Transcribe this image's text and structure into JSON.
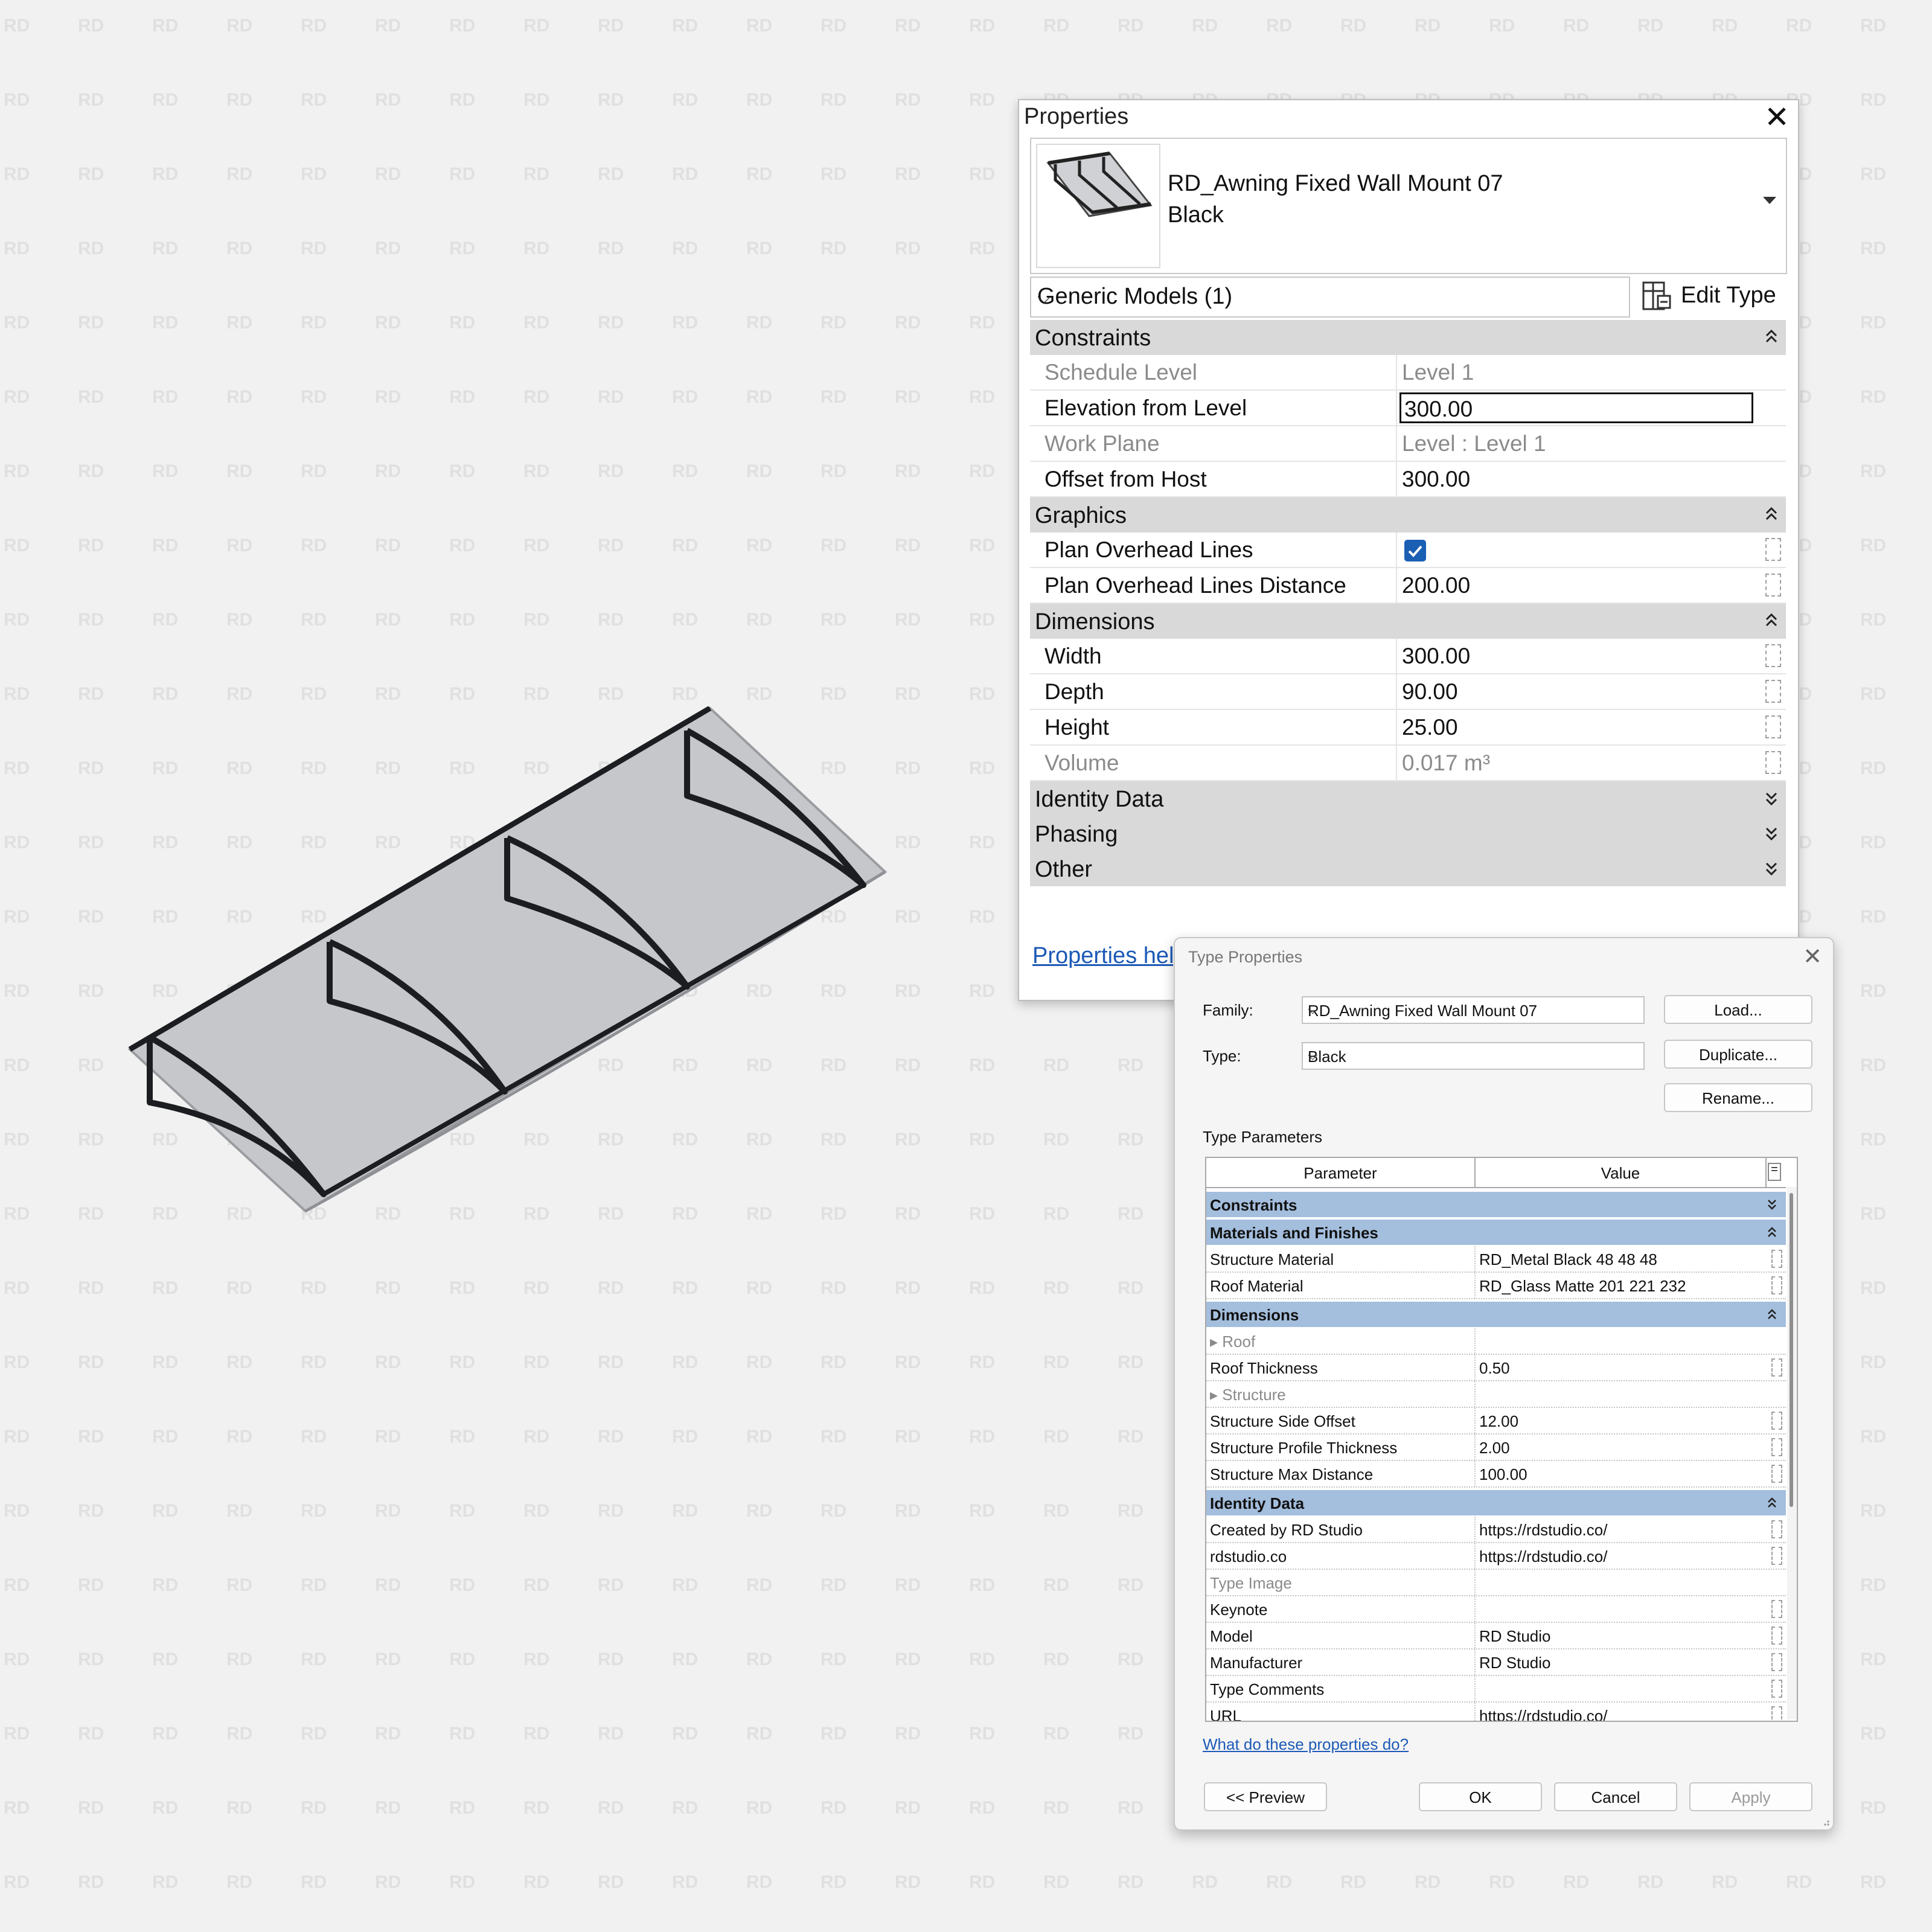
{
  "colors": {
    "background": "#f1f1f1",
    "section_header": "#d9d9d9",
    "type_section_header": "#a4bedd",
    "link": "#1c5ab6",
    "checkbox": "#1a5fb4",
    "awning_glass": "#c5c7cb",
    "awning_frame": "#1b1d20"
  },
  "watermark": "RD",
  "properties": {
    "title": "Properties",
    "close_icon": "close-icon",
    "type_name_line1": "RD_Awning Fixed Wall Mount 07",
    "type_name_line2": "Black",
    "category": "Generic Models (1)",
    "edit_type": "Edit Type",
    "sections": {
      "constraints": "Constraints",
      "graphics": "Graphics",
      "dimensions": "Dimensions",
      "identity": "Identity Data",
      "phasing": "Phasing",
      "other": "Other"
    },
    "rows": {
      "schedule_level": {
        "label": "Schedule Level",
        "value": "Level 1"
      },
      "elevation_from_level": {
        "label": "Elevation from Level",
        "value": "300.00"
      },
      "work_plane": {
        "label": "Work Plane",
        "value": "Level : Level 1"
      },
      "offset_from_host": {
        "label": "Offset from Host",
        "value": "300.00"
      },
      "plan_overhead_lines": {
        "label": "Plan Overhead Lines",
        "checked": true
      },
      "plan_overhead_distance": {
        "label": "Plan Overhead Lines Distance",
        "value": "200.00"
      },
      "width": {
        "label": "Width",
        "value": "300.00"
      },
      "depth": {
        "label": "Depth",
        "value": "90.00"
      },
      "height": {
        "label": "Height",
        "value": "25.00"
      },
      "volume": {
        "label": "Volume",
        "value": "0.017 m³"
      }
    },
    "help_link": "Properties help"
  },
  "type_properties": {
    "title": "Type Properties",
    "family_label": "Family:",
    "family_value": "RD_Awning Fixed Wall Mount 07",
    "type_label": "Type:",
    "type_value": "Black",
    "load": "Load...",
    "duplicate": "Duplicate...",
    "rename": "Rename...",
    "type_parameters": "Type Parameters",
    "col_parameter": "Parameter",
    "col_value": "Value",
    "col_equals": "=",
    "sections": {
      "constraints": "Constraints",
      "materials": "Materials and Finishes",
      "dimensions": "Dimensions",
      "identity": "Identity Data"
    },
    "rows": {
      "structure_material": {
        "label": "Structure Material",
        "value": "RD_Metal Black 48 48 48"
      },
      "roof_material": {
        "label": "Roof Material",
        "value": "RD_Glass Matte 201 221 232"
      },
      "roof_group": {
        "label": "Roof"
      },
      "roof_thickness": {
        "label": "Roof Thickness",
        "value": "0.50"
      },
      "structure_group": {
        "label": "Structure"
      },
      "structure_side_offset": {
        "label": "Structure Side Offset",
        "value": "12.00"
      },
      "structure_profile_thickness": {
        "label": "Structure Profile Thickness",
        "value": "2.00"
      },
      "structure_max_distance": {
        "label": "Structure Max Distance",
        "value": "100.00"
      },
      "created_by": {
        "label": "Created by RD Studio",
        "value": "https://rdstudio.co/"
      },
      "rdstudio": {
        "label": "rdstudio.co",
        "value": "https://rdstudio.co/"
      },
      "type_image": {
        "label": "Type Image",
        "value": ""
      },
      "keynote": {
        "label": "Keynote",
        "value": ""
      },
      "model": {
        "label": "Model",
        "value": "RD Studio"
      },
      "manufacturer": {
        "label": "Manufacturer",
        "value": "RD Studio"
      },
      "type_comments": {
        "label": "Type Comments",
        "value": ""
      },
      "url": {
        "label": "URL",
        "value": "https://rdstudio.co/"
      }
    },
    "what_link": "What do these properties do?",
    "preview": "<< Preview",
    "ok": "OK",
    "cancel": "Cancel",
    "apply": "Apply"
  }
}
